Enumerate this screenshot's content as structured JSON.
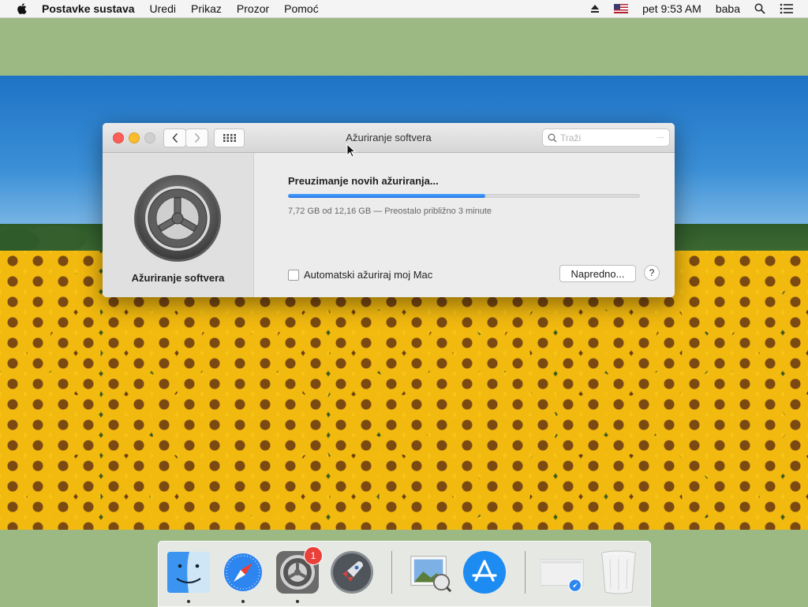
{
  "menubar": {
    "app_name": "Postavke sustava",
    "items": [
      "Uredi",
      "Prikaz",
      "Prozor",
      "Pomoć"
    ],
    "clock": "pet 9:53 AM",
    "user": "baba"
  },
  "window": {
    "title": "Ažuriranje softvera",
    "search_placeholder": "Traži",
    "sidebar_label": "Ažuriranje softvera",
    "heading": "Preuzimanje novih ažuriranja...",
    "progress_fraction": 0.56,
    "status_text": "7,72 GB od 12,16 GB — Preostalo približno 3 minute",
    "auto_update_label": "Automatski ažuriraj moj Mac",
    "auto_update_checked": false,
    "advanced_button": "Napredno...",
    "help_button": "?"
  },
  "dock": {
    "items": [
      {
        "name": "Finder",
        "icon": "finder-icon",
        "running": true
      },
      {
        "name": "Safari",
        "icon": "safari-icon",
        "running": true
      },
      {
        "name": "Postavke sustava",
        "icon": "system-preferences-icon",
        "running": true,
        "badge": "1"
      },
      {
        "name": "Launchpad",
        "icon": "launchpad-icon",
        "running": false
      },
      {
        "name": "Pregled",
        "icon": "preview-icon",
        "running": false
      },
      {
        "name": "App Store",
        "icon": "app-store-icon",
        "running": false
      },
      {
        "name": "Downloads",
        "icon": "downloads-stack-icon",
        "running": false
      },
      {
        "name": "Smeće",
        "icon": "trash-icon",
        "running": false
      }
    ]
  },
  "colors": {
    "progress": "#2f80ed",
    "close": "#fc5f57",
    "minimize": "#fdbc2e",
    "badge": "#e9403a"
  }
}
